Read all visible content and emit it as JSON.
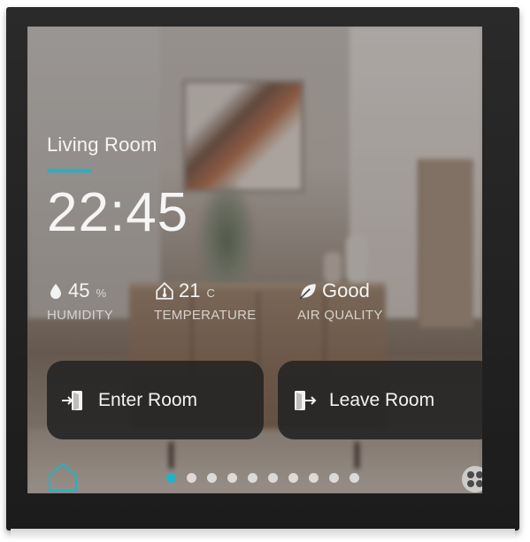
{
  "room": {
    "name": "Living Room",
    "time": "22:45"
  },
  "metrics": {
    "humidity": {
      "value": "45",
      "unit": "%",
      "label": "HUMIDITY",
      "icon": "water-drop-icon"
    },
    "temperature": {
      "value": "21",
      "unit": "C",
      "label": "TEMPERATURE",
      "icon": "home-thermometer-icon"
    },
    "air_quality": {
      "value": "Good",
      "label": "AIR QUALITY",
      "icon": "leaf-icon"
    }
  },
  "scenes": [
    {
      "label": "Enter Room",
      "icon": "enter-door-icon"
    },
    {
      "label": "Leave Room",
      "icon": "leave-door-icon"
    }
  ],
  "pager": {
    "total": 10,
    "active_index": 0
  },
  "colors": {
    "accent": "#21b3c7",
    "button_bg": "#262626",
    "text": "#f5f5f5"
  },
  "nav": {
    "home_icon": "home-icon",
    "apps_icon": "apps-grid-icon"
  }
}
